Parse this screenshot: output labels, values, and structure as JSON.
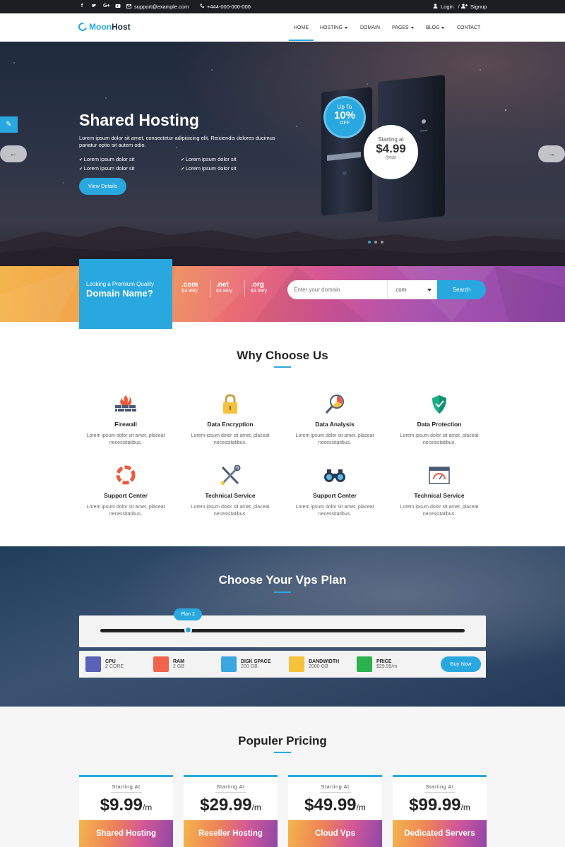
{
  "topbar": {
    "social": [
      "f",
      "t",
      "G+",
      "yt"
    ],
    "email": "support@example.com",
    "phone": "+444-000-000-000",
    "login": "Login",
    "signup": "Signup"
  },
  "nav": {
    "logo_moon": "Moon",
    "logo_host": "Host",
    "items": [
      "HOME",
      "HOSTING",
      "DOMAIN",
      "PAGES",
      "BLOG",
      "CONTACT"
    ],
    "active": "HOME"
  },
  "hero": {
    "title": "Shared Hosting",
    "description": "Lorem ipsum dolor sit amet, consectetur adipisicing elit. Reiciendis dolores ducimus pariatur optio sit autem odio.",
    "list_left": [
      "Lorem ipsum dolor sit",
      "Lorem ipsum dolor sit"
    ],
    "list_right": [
      "Lorem ipsum dolor sit",
      "Lorem ipsum dolor sit"
    ],
    "button": "View Details",
    "discount": {
      "up": "Up To",
      "pct": "10%",
      "off": "OFF"
    },
    "price": {
      "starting": "Starting at",
      "amount": "$4.99",
      "period": "/year"
    },
    "prev": "←",
    "next": "→"
  },
  "domain": {
    "looking": "Looking a Premium Quality",
    "name": "Domain Name?",
    "tlds": [
      {
        "tld": ".com",
        "price": "$3.99/y"
      },
      {
        "tld": ".net",
        "price": "$3.99/y"
      },
      {
        "tld": ".org",
        "price": "$3.99/y"
      }
    ],
    "placeholder": "Enter your domain",
    "selected_tld": ".com",
    "search": "Search"
  },
  "why": {
    "title": "Why Choose Us",
    "features": [
      {
        "title": "Firewall",
        "desc": "Lorem ipsum dolor sit amet, placeat necessitatibus."
      },
      {
        "title": "Data Encryption",
        "desc": "Lorem ipsum dolor sit amet, placeat necessitatibus."
      },
      {
        "title": "Data Analysis",
        "desc": "Lorem ipsum dolor sit amet, placeat necessitatibus."
      },
      {
        "title": "Data Protection",
        "desc": "Lorem ipsum dolor sit amet, placeat necessitatibus."
      },
      {
        "title": "Support Center",
        "desc": "Lorem ipsum dolor sit amet, placeat necessitatibus."
      },
      {
        "title": "Technical Service",
        "desc": "Lorem ipsum dolor sit amet, placeat necessitatibus."
      },
      {
        "title": "Support Center",
        "desc": "Lorem ipsum dolor sit amet, placeat necessitatibus."
      },
      {
        "title": "Technical Service",
        "desc": "Lorem ipsum dolor sit amet, placeat necessitatibus."
      }
    ]
  },
  "vps": {
    "title": "Choose Your Vps Plan",
    "plan_label": "Plan 2",
    "slider_value": 0.25,
    "specs": [
      {
        "name": "CPU",
        "value": "2 CORE",
        "color": "#5a62b8"
      },
      {
        "name": "RAM",
        "value": "2 GB",
        "color": "#f0644b"
      },
      {
        "name": "DISK SPACE",
        "value": "200 GB",
        "color": "#3aa7e0"
      },
      {
        "name": "BANDWIDTH",
        "value": "2000 GB",
        "color": "#f6c23c"
      },
      {
        "name": "PRICE",
        "value": "$29.99/m",
        "color": "#2bb24c"
      }
    ],
    "buy": "Buy Now"
  },
  "pricing": {
    "title": "Populer Pricing",
    "cards": [
      {
        "starting": "Starting At",
        "amount": "$9.99",
        "per": "/m",
        "name": "Shared Hosting"
      },
      {
        "starting": "Starting At",
        "amount": "$29.99",
        "per": "/m",
        "name": "Reseller Hosting"
      },
      {
        "starting": "Starting At",
        "amount": "$49.99",
        "per": "/m",
        "name": "Cloud Vps"
      },
      {
        "starting": "Starting At",
        "amount": "$99.99",
        "per": "/m",
        "name": "Dedicated Servers"
      }
    ]
  },
  "colors": {
    "accent": "#29a8e0",
    "dark": "#1c1e22"
  }
}
